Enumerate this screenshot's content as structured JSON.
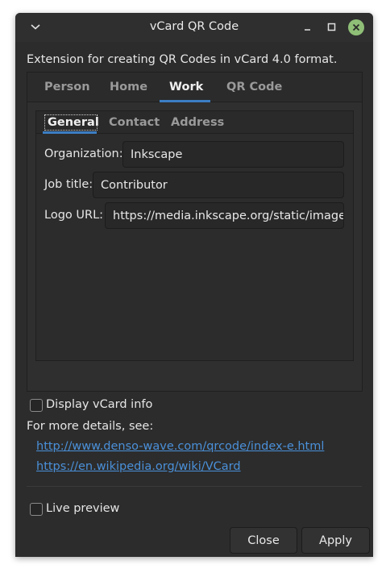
{
  "window": {
    "title": "vCard QR Code"
  },
  "description": "Extension for creating QR Codes in vCard 4.0 format.",
  "main_tabs": [
    {
      "label": "Person",
      "active": false
    },
    {
      "label": "Home",
      "active": false
    },
    {
      "label": "Work",
      "active": true
    },
    {
      "label": "QR Code",
      "active": false
    }
  ],
  "sub_tabs": [
    {
      "label": "General",
      "active": true
    },
    {
      "label": "Contact",
      "active": false
    },
    {
      "label": "Address",
      "active": false
    }
  ],
  "fields": {
    "organization": {
      "label": "Organization:",
      "value": "Inkscape"
    },
    "job_title": {
      "label": "Job title:",
      "value": "Contributor"
    },
    "logo_url": {
      "label": "Logo URL:",
      "value": "https://media.inkscape.org/static/images/inkscape-logo.svg"
    }
  },
  "display_vcard": {
    "label": "Display vCard info",
    "checked": false
  },
  "details_text": "For more details, see:",
  "links": [
    "http://www.denso-wave.com/qrcode/index-e.html",
    "https://en.wikipedia.org/wiki/VCard"
  ],
  "live_preview": {
    "label": "Live preview",
    "checked": false
  },
  "buttons": {
    "close": "Close",
    "apply": "Apply"
  },
  "colors": {
    "accent": "#3c7ec4",
    "link": "#4a90d9",
    "window_bg": "#2c2c2c",
    "close_button": "#8fbf77"
  }
}
